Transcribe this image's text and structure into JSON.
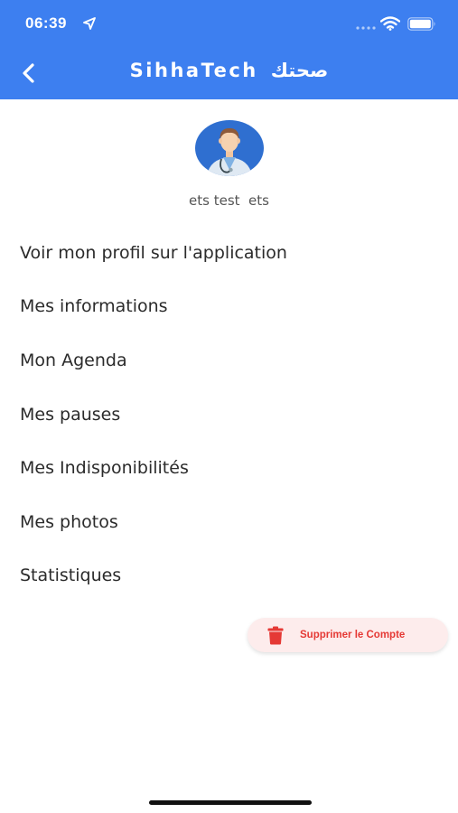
{
  "status_bar": {
    "time": "06:39",
    "icons": [
      "location-arrow-icon",
      "signal-dots-icon",
      "wifi-icon",
      "battery-icon"
    ]
  },
  "header": {
    "title": "SihhaTech",
    "title_arabic": "صحتك",
    "back_icon": "chevron-left-icon",
    "background_color": "#3d7ff0"
  },
  "profile": {
    "avatar_icon": "doctor-avatar-icon",
    "name": "ets test  ets"
  },
  "menu": {
    "items": [
      {
        "label": "Voir mon profil sur l'application"
      },
      {
        "label": "Mes informations"
      },
      {
        "label": "Mon Agenda"
      },
      {
        "label": "Mes pauses"
      },
      {
        "label": "Mes Indisponibilités"
      },
      {
        "label": "Mes photos"
      },
      {
        "label": "Statistiques"
      }
    ]
  },
  "delete_account": {
    "label": "Supprimer le Compte",
    "icon": "trash-icon",
    "color": "#e53935"
  }
}
